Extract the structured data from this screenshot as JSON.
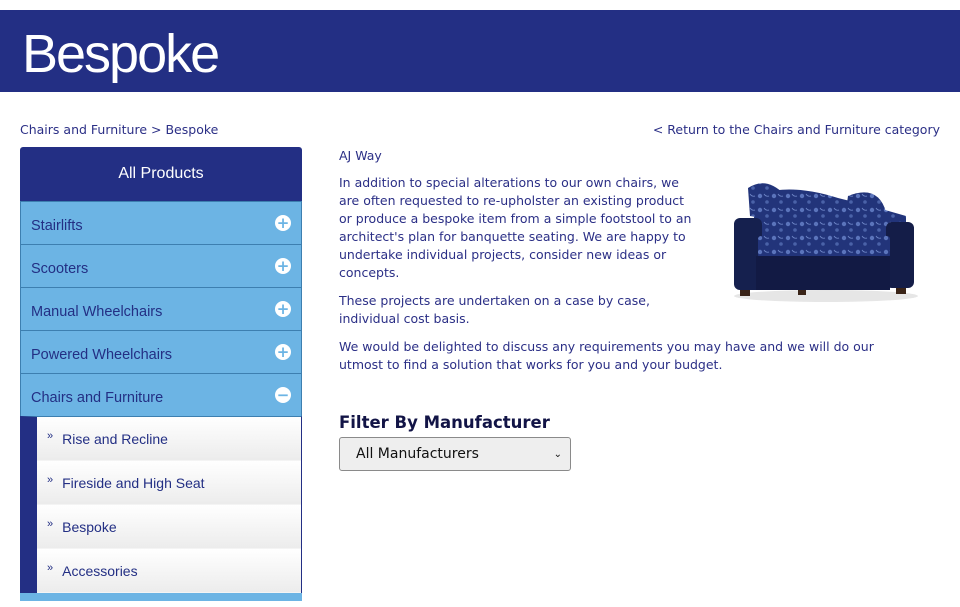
{
  "banner": {
    "title": "Bespoke"
  },
  "breadcrumb": {
    "parent": "Chairs and Furniture",
    "separator": ">",
    "current": "Bespoke"
  },
  "return_link": "< Return to the Chairs and Furniture category",
  "sidebar": {
    "header": "All Products",
    "categories": [
      {
        "label": "Stairlifts",
        "toggle": "+"
      },
      {
        "label": "Scooters",
        "toggle": "+"
      },
      {
        "label": "Manual Wheelchairs",
        "toggle": "+"
      },
      {
        "label": "Powered Wheelchairs",
        "toggle": "+"
      },
      {
        "label": "Chairs and Furniture",
        "toggle": "−"
      }
    ],
    "subcategories": [
      {
        "label": "Rise and Recline",
        "chevron": "»"
      },
      {
        "label": "Fireside and High Seat",
        "chevron": "»"
      },
      {
        "label": "Bespoke",
        "chevron": "»"
      },
      {
        "label": "Accessories",
        "chevron": "»"
      }
    ]
  },
  "content": {
    "product_name": "AJ Way",
    "paragraphs": [
      "In addition to special alterations to our own chairs, we are often requested to re-upholster an existing product or produce a bespoke item from a simple footstool to an architect's plan for banquette seating. We are happy to undertake individual projects, consider new ideas or concepts.",
      "These projects are undertaken on a case by case, individual cost basis.",
      "We would be delighted to discuss any requirements you may have and we will do our utmost to find a solution that works for you and your budget."
    ]
  },
  "filter": {
    "title": "Filter By Manufacturer",
    "selected": "All Manufacturers",
    "arrow": "⌄"
  },
  "colors": {
    "banner": "#232f84",
    "category": "#6cb4e4",
    "text": "#2b2f86"
  }
}
